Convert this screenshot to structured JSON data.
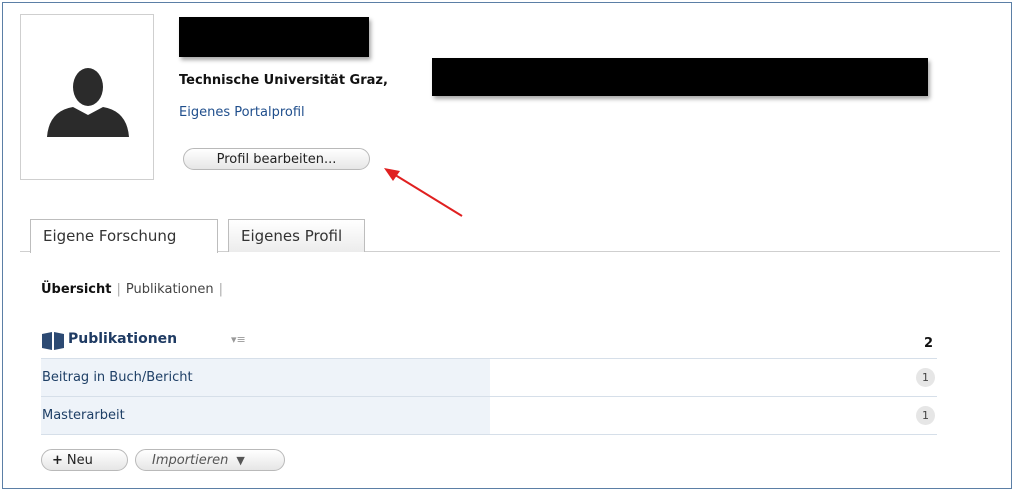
{
  "profile": {
    "org_text": "Technische Universität Graz,",
    "portal_link": "Eigenes Portalprofil",
    "edit_button": "Profil bearbeiten..."
  },
  "tabs": [
    {
      "label": "Eigene Forschung",
      "active": true
    },
    {
      "label": "Eigenes Profil",
      "active": false
    }
  ],
  "subnav": {
    "current": "Übersicht",
    "sep": "|",
    "items": [
      "Publikationen"
    ]
  },
  "publications": {
    "title": "Publikationen",
    "menu_glyph": "▾≡",
    "total": "2",
    "rows": [
      {
        "label": "Beitrag in Buch/Bericht",
        "count": "1"
      },
      {
        "label": "Masterarbeit",
        "count": "1"
      }
    ]
  },
  "actions": {
    "new_symbol": "+",
    "new_label": "Neu",
    "import_label": "Importieren",
    "import_caret": "▼"
  },
  "colors": {
    "frame_border": "#5b7fa6",
    "link": "#1f4e8c",
    "row_bg": "#eef3f9",
    "annotation_arrow": "#e02020"
  },
  "icons": {
    "avatar": "person-silhouette-icon",
    "book": "book-icon",
    "arrow": "red-arrow-annotation-icon"
  }
}
